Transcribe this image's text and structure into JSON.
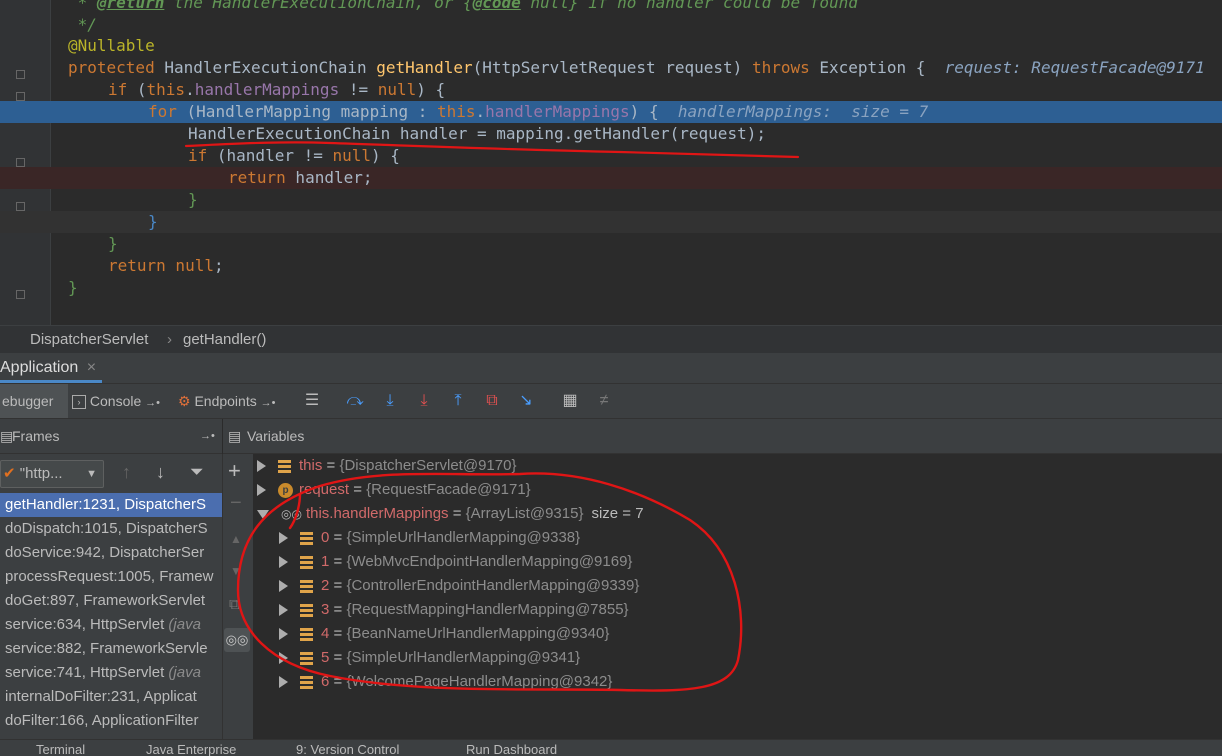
{
  "editor": {
    "lines": {
      "l0": {
        "star": " * ",
        "tag1": "@return",
        "t1": " the HandlerExecutionChain, or {",
        "tag2": "@code",
        "t2": " null} if no handler could be found"
      },
      "l1": {
        "text": " */"
      },
      "l2": {
        "text": "@Nullable"
      },
      "l3": {
        "kw": "protected",
        "type": " HandlerExecutionChain ",
        "fn": "getHandler",
        "params": "(HttpServletRequest request) ",
        "throws": "throws",
        "exc": " Exception {",
        "hint": "  request: RequestFacade@9171"
      },
      "l4": {
        "kw": "if",
        "a": " (",
        "this": "this",
        "dot": ".",
        "fld": "handlerMappings",
        "b": " != ",
        "nul": "null",
        "c": ") {"
      },
      "l5": {
        "kw": "for",
        "a": " (HandlerMapping mapping : ",
        "this": "this",
        "dot": ".",
        "fld": "handlerMappings",
        "c": ") {",
        "hint": "  handlerMappings:  size = 7"
      },
      "l6": {
        "text": "HandlerExecutionChain handler = mapping.getHandler(request);"
      },
      "l7": {
        "kw": "if",
        "a": " (handler != ",
        "nul": "null",
        "c": ") {"
      },
      "l8": {
        "kw": "return",
        "a": " handler;"
      },
      "l9": {
        "text": "}"
      },
      "l10": {
        "text": "}"
      },
      "l11": {
        "text": "}"
      },
      "l12": {
        "kw": "return",
        "nul": " null",
        "a": ";"
      },
      "l13": {
        "text": "}"
      }
    }
  },
  "breadcrumb": {
    "class_name": "DispatcherServlet",
    "separator": "›",
    "method": "getHandler()"
  },
  "app_tab": {
    "label": "Application",
    "close": "×"
  },
  "toolbar": {
    "debugger_label": "ebugger",
    "console_label": "Console",
    "endpoints_label": "Endpoints",
    "pin": "→•"
  },
  "frames_panel": {
    "title": "Frames",
    "thread": "\"http...",
    "pin": "→•"
  },
  "variables_panel": {
    "title": "Variables"
  },
  "frames": [
    {
      "text": "getHandler:1231, DispatcherS",
      "italic": ""
    },
    {
      "text": "doDispatch:1015, DispatcherS",
      "italic": ""
    },
    {
      "text": "doService:942, DispatcherSer",
      "italic": ""
    },
    {
      "text": "processRequest:1005, Framew",
      "italic": ""
    },
    {
      "text": "doGet:897, FrameworkServlet",
      "italic": ""
    },
    {
      "text": "service:634, HttpServlet ",
      "italic": "(java"
    },
    {
      "text": "service:882, FrameworkServle",
      "italic": ""
    },
    {
      "text": "service:741, HttpServlet ",
      "italic": "(java"
    },
    {
      "text": "internalDoFilter:231, Applicat",
      "italic": ""
    },
    {
      "text": "doFilter:166, ApplicationFilter",
      "italic": ""
    }
  ],
  "variables": [
    {
      "name": "this",
      "value": "{DispatcherServlet@9170}",
      "size": ""
    },
    {
      "name": "request",
      "value": "{RequestFacade@9171}",
      "size": ""
    },
    {
      "name": "this.handlerMappings",
      "value": "{ArrayList@9315}",
      "size": "size = 7"
    }
  ],
  "mappings": [
    {
      "index": "0",
      "value": "{SimpleUrlHandlerMapping@9338}"
    },
    {
      "index": "1",
      "value": "{WebMvcEndpointHandlerMapping@9169}"
    },
    {
      "index": "2",
      "value": "{ControllerEndpointHandlerMapping@9339}"
    },
    {
      "index": "3",
      "value": "{RequestMappingHandlerMapping@7855}"
    },
    {
      "index": "4",
      "value": "{BeanNameUrlHandlerMapping@9340}"
    },
    {
      "index": "5",
      "value": "{SimpleUrlHandlerMapping@9341}"
    },
    {
      "index": "6",
      "value": "{WelcomePageHandlerMapping@9342}"
    }
  ],
  "equals": " = ",
  "bottom_tabs": [
    "Terminal",
    "Java Enterprise",
    "9: Version Control",
    "Run Dashboard"
  ],
  "colors": {
    "annotation_ink": "#e01515",
    "selection": "#2d5f93",
    "accent": "#4a88c7"
  }
}
